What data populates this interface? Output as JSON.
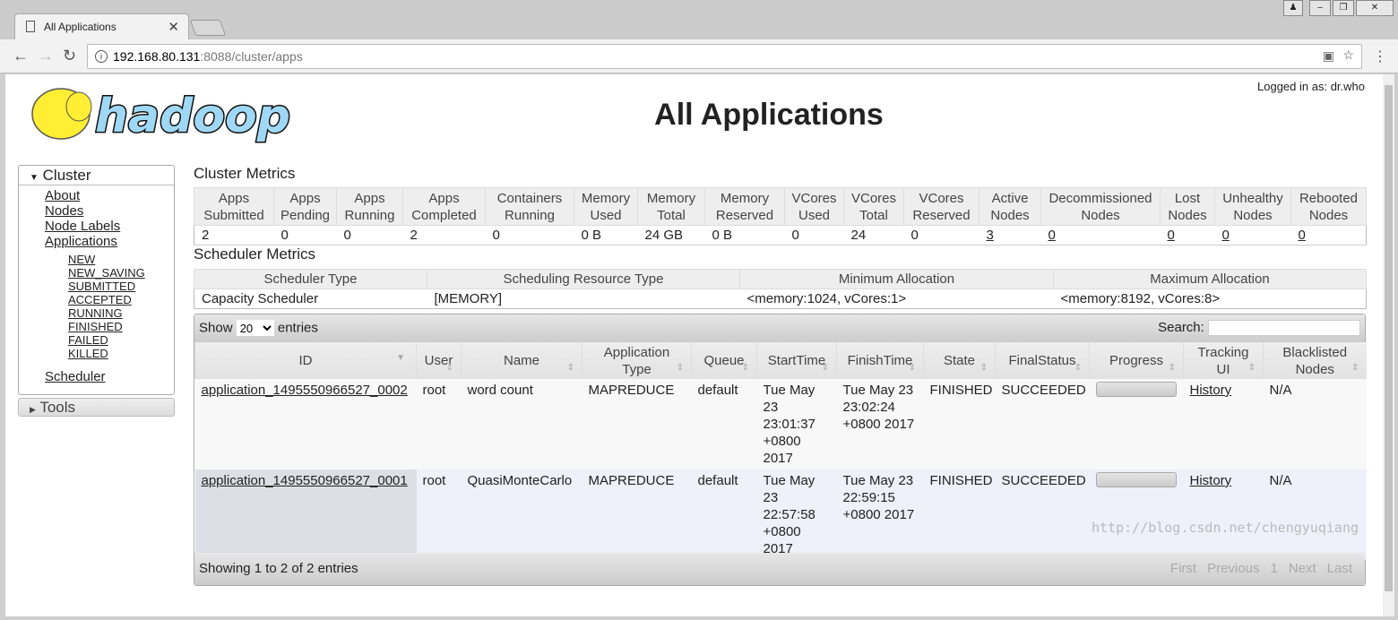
{
  "browser": {
    "tab_title": "All Applications",
    "url_host": "192.168.80.131",
    "url_rest": ":8088/cluster/apps"
  },
  "header": {
    "title": "All Applications",
    "login": "Logged in as: dr.who",
    "logo": "hadoop"
  },
  "sidebar": {
    "cluster_label": "Cluster",
    "items": [
      "About",
      "Nodes",
      "Node Labels",
      "Applications"
    ],
    "states": [
      "NEW",
      "NEW_SAVING",
      "SUBMITTED",
      "ACCEPTED",
      "RUNNING",
      "FINISHED",
      "FAILED",
      "KILLED"
    ],
    "scheduler": "Scheduler",
    "tools_label": "Tools"
  },
  "cluster_metrics": {
    "title": "Cluster Metrics",
    "headers": [
      [
        "Apps",
        "Submitted"
      ],
      [
        "Apps",
        "Pending"
      ],
      [
        "Apps",
        "Running"
      ],
      [
        "Apps",
        "Completed"
      ],
      [
        "Containers",
        "Running"
      ],
      [
        "Memory",
        "Used"
      ],
      [
        "Memory",
        "Total"
      ],
      [
        "Memory",
        "Reserved"
      ],
      [
        "VCores",
        "Used"
      ],
      [
        "VCores",
        "Total"
      ],
      [
        "VCores",
        "Reserved"
      ],
      [
        "Active",
        "Nodes"
      ],
      [
        "Decommissioned",
        "Nodes"
      ],
      [
        "Lost",
        "Nodes"
      ],
      [
        "Unhealthy",
        "Nodes"
      ],
      [
        "Rebooted",
        "Nodes"
      ]
    ],
    "values": [
      "2",
      "0",
      "0",
      "2",
      "0",
      "0 B",
      "24 GB",
      "0 B",
      "0",
      "24",
      "0",
      "3",
      "0",
      "0",
      "0",
      "0"
    ]
  },
  "scheduler_metrics": {
    "title": "Scheduler Metrics",
    "headers": [
      "Scheduler Type",
      "Scheduling Resource Type",
      "Minimum Allocation",
      "Maximum Allocation"
    ],
    "values": [
      "Capacity Scheduler",
      "[MEMORY]",
      "<memory:1024, vCores:1>",
      "<memory:8192, vCores:8>"
    ]
  },
  "apps": {
    "show_label": "Show",
    "entries_value": "20",
    "entries_label": "entries",
    "search_label": "Search:",
    "search_value": "",
    "headers": [
      [
        "ID"
      ],
      [
        "User"
      ],
      [
        "Name"
      ],
      [
        "Application",
        "Type"
      ],
      [
        "Queue"
      ],
      [
        "StartTime"
      ],
      [
        "FinishTime"
      ],
      [
        "State"
      ],
      [
        "FinalStatus"
      ],
      [
        "Progress"
      ],
      [
        "Tracking",
        "UI"
      ],
      [
        "Blacklisted",
        "Nodes"
      ]
    ],
    "rows": [
      {
        "id": "application_1495550966527_0002",
        "user": "root",
        "name": "word count",
        "type": "MAPREDUCE",
        "queue": "default",
        "start": "Tue May 23 23:01:37 +0800 2017",
        "finish": "Tue May 23 23:02:24 +0800 2017",
        "state": "FINISHED",
        "final": "SUCCEEDED",
        "progress": 100,
        "tracking": "History",
        "blacklisted": "N/A"
      },
      {
        "id": "application_1495550966527_0001",
        "user": "root",
        "name": "QuasiMonteCarlo",
        "type": "MAPREDUCE",
        "queue": "default",
        "start": "Tue May 23 22:57:58 +0800 2017",
        "finish": "Tue May 23 22:59:15 +0800 2017",
        "state": "FINISHED",
        "final": "SUCCEEDED",
        "progress": 100,
        "tracking": "History",
        "blacklisted": "N/A"
      }
    ],
    "info": "Showing 1 to 2 of 2 entries",
    "pager": [
      "First",
      "Previous",
      "1",
      "Next",
      "Last"
    ]
  },
  "watermark": "http://blog.csdn.net/chengyuqiang"
}
